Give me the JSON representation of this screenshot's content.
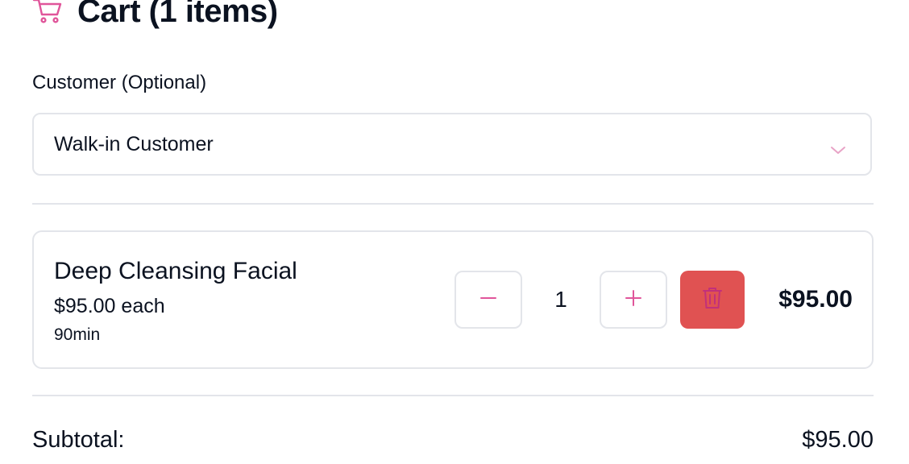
{
  "header": {
    "title": "Cart (1 items)",
    "cart_icon": "shopping-cart-icon"
  },
  "customer": {
    "label": "Customer (Optional)",
    "selected": "Walk-in Customer",
    "dropdown_icon": "chevron-down-icon"
  },
  "cart": {
    "items": [
      {
        "name": "Deep Cleansing Facial",
        "unit_price": "$95.00 each",
        "duration": "90min",
        "quantity": "1",
        "line_total": "$95.00",
        "decrement_icon": "minus-icon",
        "increment_icon": "plus-icon",
        "delete_icon": "trash-icon"
      }
    ]
  },
  "summary": {
    "subtotal_label": "Subtotal:",
    "subtotal_value": "$95.00"
  },
  "colors": {
    "accent_pink": "#e0559a",
    "delete_red": "#e05252",
    "border": "#e3e5ea",
    "text": "#0b1220"
  }
}
